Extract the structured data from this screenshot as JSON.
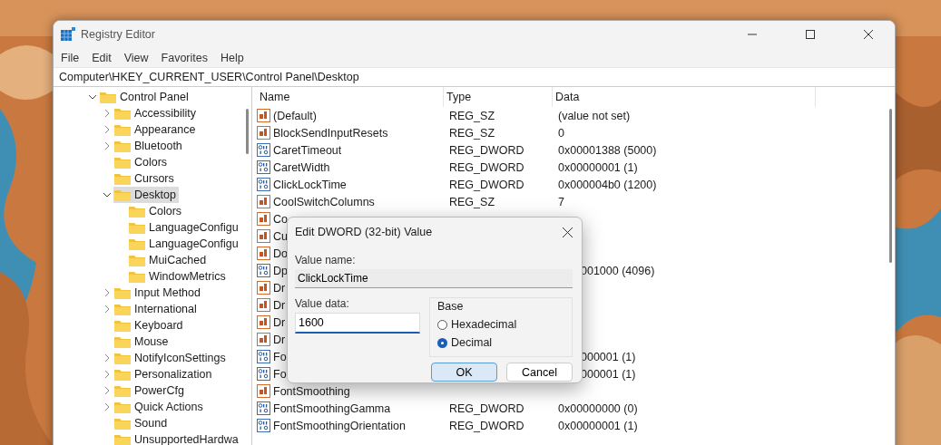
{
  "window": {
    "title": "Registry Editor"
  },
  "menu": [
    "File",
    "Edit",
    "View",
    "Favorites",
    "Help"
  ],
  "address": "Computer\\HKEY_CURRENT_USER\\Control Panel\\Desktop",
  "tree": [
    {
      "label": "Control Panel",
      "expanded": true,
      "selected": false,
      "children": [
        {
          "label": "Accessibility",
          "expanded": false,
          "selected": false
        },
        {
          "label": "Appearance",
          "expanded": false,
          "selected": false
        },
        {
          "label": "Bluetooth",
          "expanded": false,
          "selected": false
        },
        {
          "label": "Colors",
          "selected": false
        },
        {
          "label": "Cursors",
          "selected": false
        },
        {
          "label": "Desktop",
          "expanded": true,
          "selected": true,
          "children": [
            {
              "label": "Colors",
              "selected": false
            },
            {
              "label": "LanguageConfigu",
              "selected": false
            },
            {
              "label": "LanguageConfigu",
              "selected": false
            },
            {
              "label": "MuiCached",
              "selected": false
            },
            {
              "label": "WindowMetrics",
              "selected": false
            }
          ]
        },
        {
          "label": "Input Method",
          "expanded": false,
          "selected": false
        },
        {
          "label": "International",
          "expanded": false,
          "selected": false
        },
        {
          "label": "Keyboard",
          "selected": false
        },
        {
          "label": "Mouse",
          "selected": false
        },
        {
          "label": "NotifyIconSettings",
          "expanded": false,
          "selected": false
        },
        {
          "label": "Personalization",
          "expanded": false,
          "selected": false
        },
        {
          "label": "PowerCfg",
          "expanded": false,
          "selected": false
        },
        {
          "label": "Quick Actions",
          "expanded": false,
          "selected": false
        },
        {
          "label": "Sound",
          "selected": false
        },
        {
          "label": "UnsupportedHardwa",
          "selected": false
        }
      ]
    }
  ],
  "table": {
    "columns": [
      "Name",
      "Type",
      "Data"
    ],
    "rows": [
      {
        "kind": "string",
        "name": "(Default)",
        "type": "REG_SZ",
        "data": "(value not set)"
      },
      {
        "kind": "string",
        "name": "BlockSendInputResets",
        "type": "REG_SZ",
        "data": "0"
      },
      {
        "kind": "dword",
        "name": "CaretTimeout",
        "type": "REG_DWORD",
        "data": "0x00001388 (5000)"
      },
      {
        "kind": "dword",
        "name": "CaretWidth",
        "type": "REG_DWORD",
        "data": "0x00000001 (1)"
      },
      {
        "kind": "dword",
        "name": "ClickLockTime",
        "type": "REG_DWORD",
        "data": "0x000004b0 (1200)"
      },
      {
        "kind": "string",
        "name": "CoolSwitchColumns",
        "type": "REG_SZ",
        "data": "7"
      },
      {
        "kind": "string",
        "name": "Co"
      },
      {
        "kind": "string",
        "name": "Cu"
      },
      {
        "kind": "string",
        "name": "Do"
      },
      {
        "kind": "dword",
        "name": "Dp",
        "data": "001000 (4096)"
      },
      {
        "kind": "string",
        "name": "Dr"
      },
      {
        "kind": "string",
        "name": "Dr"
      },
      {
        "kind": "string",
        "name": "Dr"
      },
      {
        "kind": "string",
        "name": "Dr"
      },
      {
        "kind": "dword",
        "name": "Fo",
        "data": "000001 (1)"
      },
      {
        "kind": "dword",
        "name": "Fo",
        "data": "000001 (1)"
      },
      {
        "kind": "string",
        "name": "FontSmoothing"
      },
      {
        "kind": "dword",
        "name": "FontSmoothingGamma",
        "type": "REG_DWORD",
        "data": "0x00000000 (0)"
      },
      {
        "kind": "dword",
        "name": "FontSmoothingOrientation",
        "type": "REG_DWORD",
        "data": "0x00000001 (1)"
      }
    ]
  },
  "dialog": {
    "title": "Edit DWORD (32-bit) Value",
    "value_name_label": "Value name:",
    "value_name": "ClickLockTime",
    "value_data_label": "Value data:",
    "value_data": "1600",
    "base_label": "Base",
    "base_options": [
      {
        "label": "Hexadecimal",
        "selected": false
      },
      {
        "label": "Decimal",
        "selected": true
      }
    ],
    "buttons": [
      {
        "label": "OK",
        "default": true
      },
      {
        "label": "Cancel",
        "default": false
      }
    ]
  }
}
